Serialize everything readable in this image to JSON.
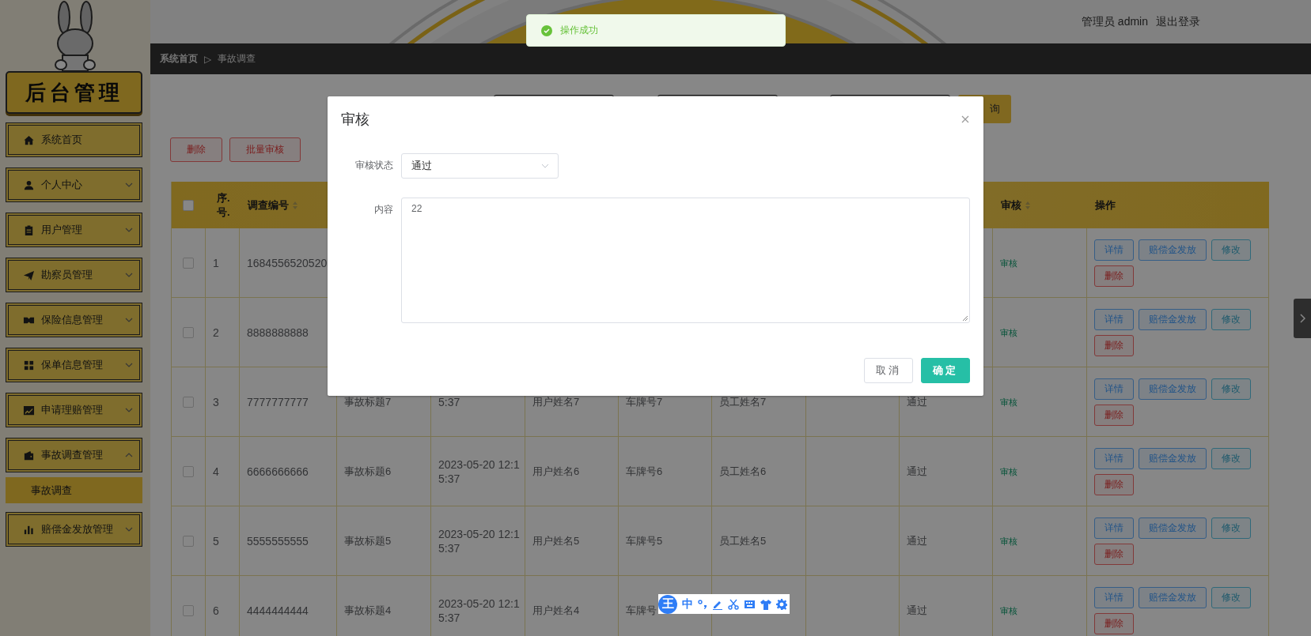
{
  "sidebar": {
    "title": "后台管理",
    "menu": [
      {
        "label": "系统首页",
        "kind": "link"
      },
      {
        "label": "个人中心",
        "kind": "group",
        "expanded": false
      },
      {
        "label": "用户管理",
        "kind": "group",
        "expanded": false
      },
      {
        "label": "勘察员管理",
        "kind": "group",
        "expanded": false
      },
      {
        "label": "保险信息管理",
        "kind": "group",
        "expanded": false
      },
      {
        "label": "保单信息管理",
        "kind": "group",
        "expanded": false
      },
      {
        "label": "申请理赔管理",
        "kind": "group",
        "expanded": false
      },
      {
        "label": "事故调查管理",
        "kind": "group",
        "expanded": true,
        "children": [
          {
            "label": "事故调查",
            "selected": true
          }
        ]
      },
      {
        "label": "赔偿金发放管理",
        "kind": "group",
        "expanded": false
      }
    ]
  },
  "header": {
    "user": "管理员 admin",
    "logout": "退出登录"
  },
  "toast": {
    "message": "操作成功"
  },
  "breadcrumb": {
    "items": [
      "系统首页",
      "事故调查"
    ],
    "separator": "▷"
  },
  "search": {
    "button": "询"
  },
  "toolbar": [
    "删除",
    "批量审核"
  ],
  "table": {
    "columns": {
      "select": {
        "checked": false
      },
      "index": {
        "label": "序.号.",
        "sortable": false
      },
      "investigation_no": {
        "label": "调查编号",
        "sortable": true
      },
      "review": {
        "label": "审核",
        "sortable": true
      },
      "actions": {
        "label": "操作",
        "sortable": false
      }
    },
    "rows": [
      {
        "checked": false,
        "index": "1",
        "investigation_no": "1684556520520",
        "review": "审核",
        "actions": [
          {
            "label": "详情",
            "kind": "primary"
          },
          {
            "label": "赔偿金发放",
            "kind": "primary"
          },
          {
            "label": "修改",
            "kind": "info"
          },
          {
            "label": "删除",
            "kind": "danger"
          }
        ]
      },
      {
        "checked": false,
        "index": "2",
        "investigation_no": "8888888888",
        "review": "审核",
        "actions": [
          {
            "label": "详情",
            "kind": "primary"
          },
          {
            "label": "赔偿金发放",
            "kind": "primary"
          },
          {
            "label": "修改",
            "kind": "info"
          },
          {
            "label": "删除",
            "kind": "danger"
          }
        ]
      },
      {
        "checked": false,
        "index": "3",
        "investigation_no": "7777777777",
        "title": "事故标题7",
        "time": "5:37",
        "user_name": "用户姓名7",
        "plate": "车牌号7",
        "staff_name": "员工姓名7",
        "status": "通过",
        "review": "审核",
        "actions": [
          {
            "label": "详情",
            "kind": "primary"
          },
          {
            "label": "赔偿金发放",
            "kind": "primary"
          },
          {
            "label": "修改",
            "kind": "info"
          },
          {
            "label": "删除",
            "kind": "danger"
          }
        ]
      },
      {
        "checked": false,
        "index": "4",
        "investigation_no": "6666666666",
        "title": "事故标题6",
        "time": "2023-05-20 12:15:37",
        "user_name": "用户姓名6",
        "plate": "车牌号6",
        "staff_name": "员工姓名6",
        "status": "通过",
        "review": "审核",
        "actions": [
          {
            "label": "详情",
            "kind": "primary"
          },
          {
            "label": "赔偿金发放",
            "kind": "primary"
          },
          {
            "label": "修改",
            "kind": "info"
          },
          {
            "label": "删除",
            "kind": "danger"
          }
        ]
      },
      {
        "checked": false,
        "index": "5",
        "investigation_no": "5555555555",
        "title": "事故标题5",
        "time": "2023-05-20 12:15:37",
        "user_name": "用户姓名5",
        "plate": "车牌号5",
        "staff_name": "员工姓名5",
        "status": "通过",
        "review": "审核",
        "actions": [
          {
            "label": "详情",
            "kind": "primary"
          },
          {
            "label": "赔偿金发放",
            "kind": "primary"
          },
          {
            "label": "修改",
            "kind": "info"
          },
          {
            "label": "删除",
            "kind": "danger"
          }
        ]
      },
      {
        "checked": false,
        "index": "6",
        "investigation_no": "4444444444",
        "title": "事故标题4",
        "time": "2023-05-20 12:15:37",
        "user_name": "用户姓名4",
        "plate": "车牌号",
        "status": "通过",
        "review": "审核",
        "actions": [
          {
            "label": "详情",
            "kind": "primary"
          },
          {
            "label": "赔偿金发放",
            "kind": "primary"
          },
          {
            "label": "修改",
            "kind": "info"
          },
          {
            "label": "删除",
            "kind": "danger"
          }
        ]
      }
    ]
  },
  "dialog": {
    "title": "审核",
    "fields": [
      {
        "kind": "select",
        "label": "审核状态",
        "value": "通过"
      },
      {
        "kind": "textarea",
        "label": "内容",
        "value": "22"
      }
    ],
    "buttons": [
      {
        "label": "取消",
        "kind": "default"
      },
      {
        "label": "确定",
        "kind": "primary"
      }
    ]
  },
  "ime": {
    "logo": "王",
    "mode": "中"
  }
}
